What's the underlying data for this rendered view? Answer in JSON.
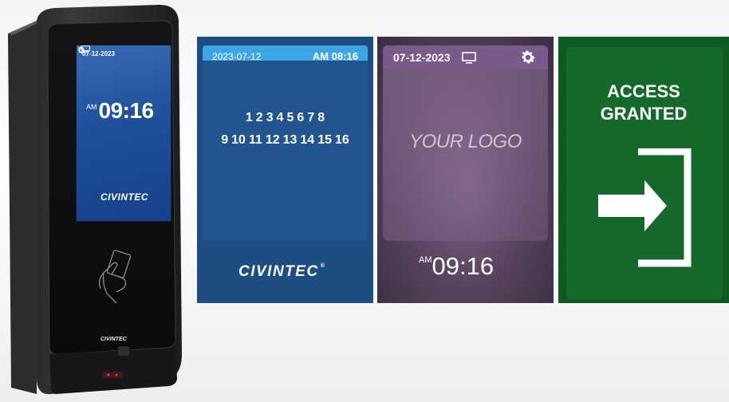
{
  "device": {
    "screen": {
      "date": "07-12-2023",
      "time_am": "AM",
      "time": "09:16",
      "logo": "CIVINTEC",
      "icons": [
        "monitor-icon",
        "gear-icon"
      ]
    },
    "brand_label": "CIVINTEC",
    "card_reader_icon": "hand-card-icon"
  },
  "panels": {
    "keypad": {
      "date": "2023-07-12",
      "time": "AM 08:16",
      "numbers_row1": [
        "1",
        "2",
        "3",
        "4",
        "5",
        "6",
        "7",
        "8"
      ],
      "numbers_row2": [
        "9",
        "10",
        "11",
        "12",
        "13",
        "14",
        "15",
        "16"
      ],
      "logo": "CIVINTEC",
      "logo_mark": "®",
      "colors": {
        "background": "#1e4d84",
        "header": "#3fa6e6"
      }
    },
    "custom_logo": {
      "date": "07-12-2023",
      "logo_text": "YOUR LOGO",
      "time_am": "AM",
      "time": "09:16",
      "icons": [
        "monitor-icon",
        "gear-icon"
      ],
      "colors": {
        "header": "#7a5a8a"
      }
    },
    "access": {
      "title_line1": "ACCESS",
      "title_line2": "GRANTED",
      "icon": "exit-arrow-icon",
      "colors": {
        "background": "#0e5a22"
      }
    }
  }
}
